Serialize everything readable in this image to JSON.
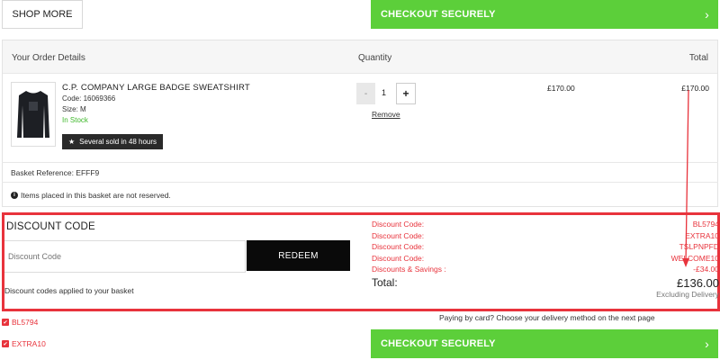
{
  "top": {
    "shop_more_label": "SHOP MORE",
    "checkout_label": "CHECKOUT SECURELY",
    "checkout_chevron": "›"
  },
  "order": {
    "headers": {
      "details": "Your Order Details",
      "quantity": "Quantity",
      "total": "Total"
    },
    "item": {
      "name": "C.P. COMPANY LARGE BADGE SWEATSHIRT",
      "code_label": "Code:",
      "code": "16069366",
      "size_label": "Size:",
      "size": "M",
      "stock": "In Stock",
      "badge": "Several sold in 48 hours",
      "quantity": "1",
      "minus": "-",
      "plus": "+",
      "remove": "Remove",
      "price": "£170.00",
      "total": "£170.00"
    },
    "basket_reference": "Basket Reference: EFFF9",
    "reservation_note": "Items placed in this basket are not reserved."
  },
  "discount": {
    "title": "DISCOUNT CODE",
    "input_placeholder": "Discount Code",
    "redeem_label": "REDEEM",
    "applied_label": "Discount codes applied to your basket",
    "codes": [
      {
        "label": "Discount Code:",
        "value": "BL5794"
      },
      {
        "label": "Discount Code:",
        "value": "EXTRA10"
      },
      {
        "label": "Discount Code:",
        "value": "TSLPNPFD"
      },
      {
        "label": "Discount Code:",
        "value": "WELCOME10"
      }
    ],
    "savings_label": "Discounts & Savings :",
    "savings_value": "-£34.00",
    "total_label": "Total:",
    "total_value": "£136.00",
    "excluding": "Excluding Delivery",
    "applied_codes": [
      "BL5794",
      "EXTRA10"
    ]
  },
  "bottom": {
    "paying_note": "Paying by card? Choose your delivery method on the next page",
    "checkout_label": "CHECKOUT SECURELY",
    "checkout_chevron": "›"
  },
  "colors": {
    "green": "#5ccf3a",
    "red": "#e8333c",
    "black": "#0a0a0a"
  }
}
